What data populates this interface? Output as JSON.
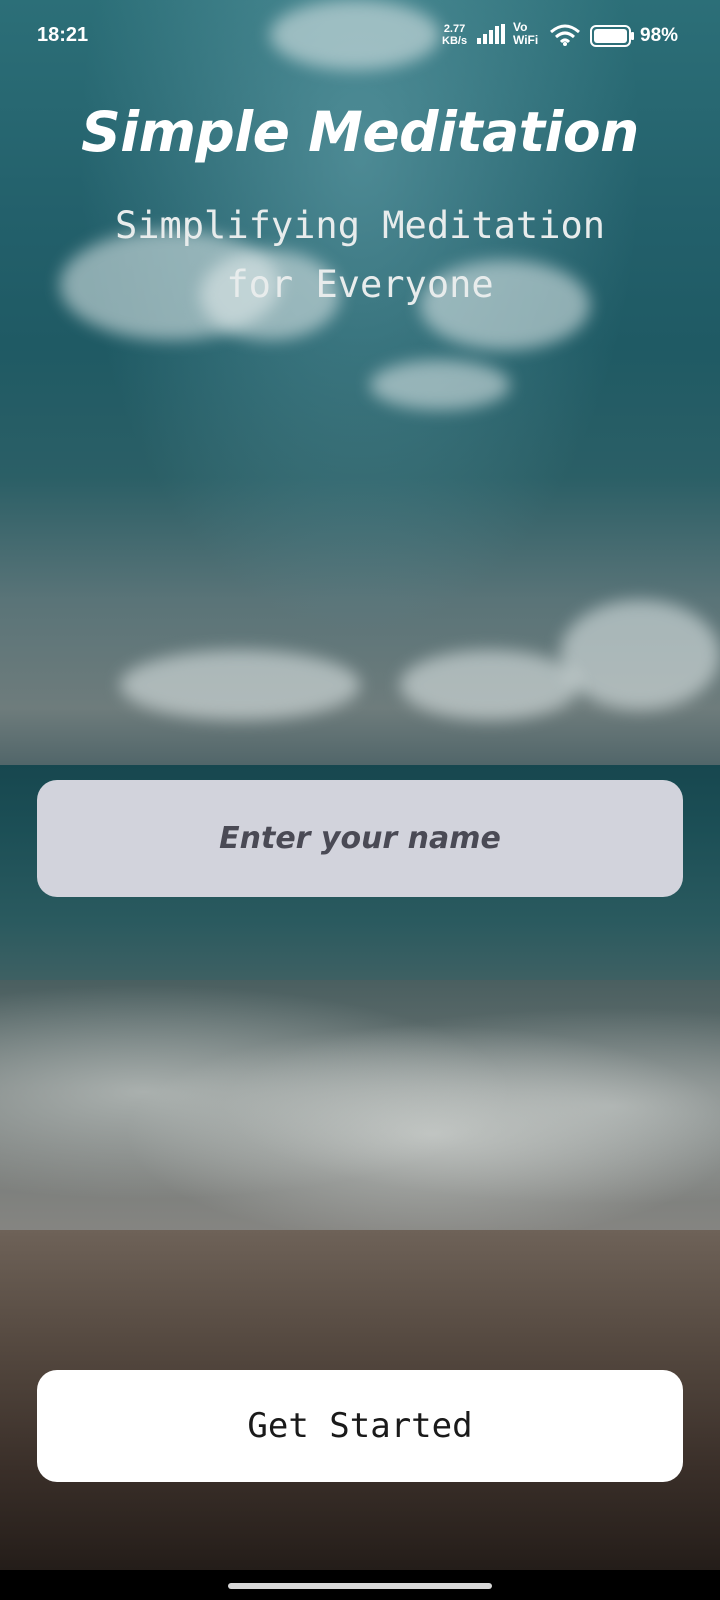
{
  "status_bar": {
    "time": "18:21",
    "net_speed_value": "2.77",
    "net_speed_unit": "KB/s",
    "vowifi_top": "Vo",
    "vowifi_bottom": "WiFi",
    "battery_percent": "98%",
    "icons": [
      "signal-icon",
      "wifi-icon",
      "battery-icon"
    ]
  },
  "header": {
    "title": "Simple Meditation",
    "subtitle_line1": "Simplifying Meditation",
    "subtitle_line2": "for Everyone"
  },
  "form": {
    "name_placeholder": "Enter your name",
    "name_value": ""
  },
  "actions": {
    "get_started_label": "Get Started"
  },
  "colors": {
    "input_background": "#d2d3dc",
    "button_background": "#ffffff",
    "title_text": "#ffffff"
  }
}
